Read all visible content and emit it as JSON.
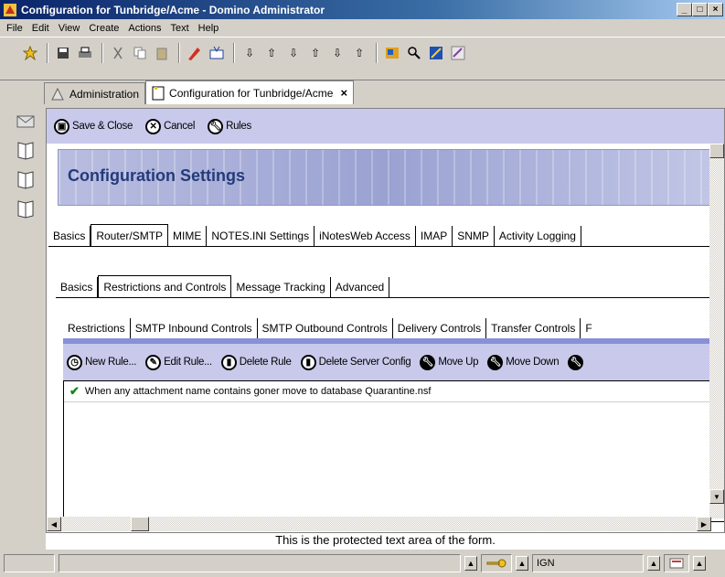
{
  "window": {
    "title": "Configuration for Tunbridge/Acme - Domino Administrator",
    "min": "_",
    "max": "□",
    "close": "×"
  },
  "menu": [
    {
      "label": "File"
    },
    {
      "label": "Edit"
    },
    {
      "label": "View"
    },
    {
      "label": "Create"
    },
    {
      "label": "Actions"
    },
    {
      "label": "Text"
    },
    {
      "label": "Help"
    }
  ],
  "wintabs": {
    "admin_label": "Administration",
    "config_label": "Configuration for Tunbridge/Acme",
    "close": "×"
  },
  "actions": {
    "save_close": "Save & Close",
    "cancel": "Cancel",
    "rules": "Rules"
  },
  "banner": {
    "title": "Configuration Settings"
  },
  "tabs_main": [
    "Basics",
    "Router/SMTP",
    "MIME",
    "NOTES.INI Settings",
    "iNotesWeb Access",
    "IMAP",
    "SNMP",
    "Activity Logging"
  ],
  "tabs_router": [
    "Basics",
    "Restrictions and Controls",
    "Message Tracking",
    "Advanced"
  ],
  "tabs_restrictions": [
    "Restrictions",
    "SMTP Inbound Controls",
    "SMTP Outbound Controls",
    "Delivery Controls",
    "Transfer Controls",
    "F"
  ],
  "rules_actions": {
    "new_rule": "New Rule...",
    "edit_rule": "Edit Rule...",
    "delete_rule": "Delete Rule",
    "delete_server_config": "Delete Server Config",
    "move_up": "Move Up",
    "move_down": "Move Down"
  },
  "rules": [
    {
      "text": "When any attachment name contains goner move to database Quarantine.nsf"
    }
  ],
  "protected_text": "This is the protected text area of the form.",
  "status": {
    "location": "IGN"
  },
  "colors": {
    "accent": "#c9c9ec",
    "title_blue": "#0a246a",
    "banner_text": "#243b7a"
  }
}
